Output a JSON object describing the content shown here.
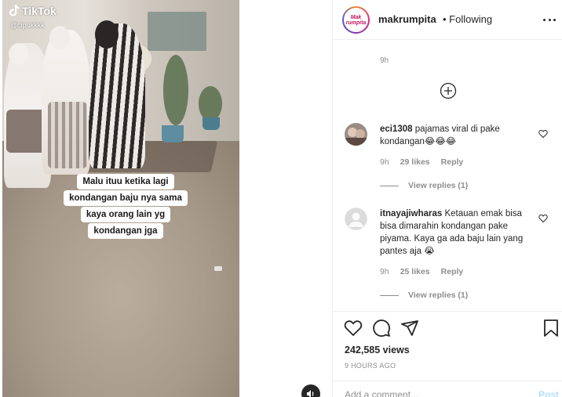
{
  "video": {
    "tiktok_logo_text": "TikTok",
    "tiktok_handle": "@cipukkkk",
    "caption_lines": [
      "Malu ituu ketika lagi",
      "kondangan baju nya sama",
      "kaya orang lain yg",
      "kondangan jga"
    ]
  },
  "header": {
    "username": "makrumpita",
    "following": "• Following",
    "avatar_text": "Mak rumpita"
  },
  "top_timestamp": "9h",
  "comments": [
    {
      "username": "eci1308",
      "text": "pajamas viral di pake kondangan😂😂😂",
      "time": "9h",
      "likes": "29 likes",
      "reply": "Reply",
      "view_replies": "View replies (1)"
    },
    {
      "username": "itnayajiwharas",
      "text": "Ketauan emak bisa bisa dimarahin kondangan pake piyama. Kaya ga ada baju lain yang pantes aja 😭",
      "time": "9h",
      "likes": "25 likes",
      "reply": "Reply",
      "view_replies": "View replies (1)"
    }
  ],
  "stats": {
    "views": "242,585 views",
    "ago": "9 HOURS AGO"
  },
  "add_comment": {
    "placeholder": "Add a comment...",
    "post_label": "Post"
  },
  "colors": {
    "text": "#262626",
    "muted": "#8e8e8e",
    "post_disabled": "#b2dffc",
    "border": "#efefef"
  }
}
